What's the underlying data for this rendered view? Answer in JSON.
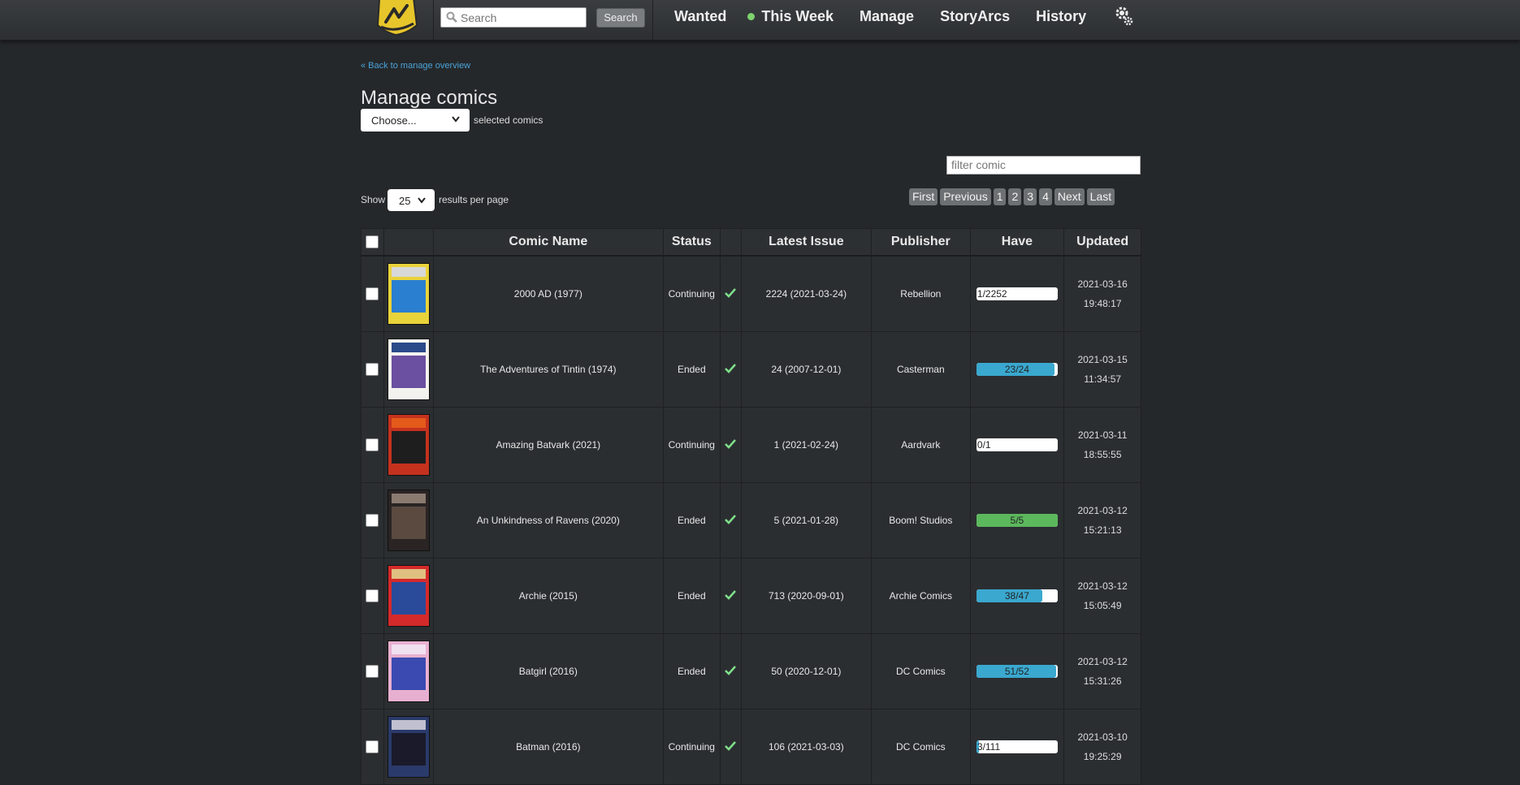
{
  "nav": {
    "search_placeholder": "Search",
    "search_button": "Search",
    "items": [
      "Wanted",
      "This Week",
      "Manage",
      "StoryArcs",
      "History"
    ],
    "active_dot_color": "#7ed36e"
  },
  "page": {
    "back_link": "« Back to manage overview",
    "title": "Manage comics",
    "action_select": "Choose...",
    "selected_label": "selected comics",
    "filter_placeholder": "filter comic",
    "show_label": "Show",
    "per_page": "25",
    "rpp_label": "results per page",
    "pager": [
      "First",
      "Previous",
      "1",
      "2",
      "3",
      "4",
      "Next",
      "Last"
    ]
  },
  "table": {
    "headers": [
      "",
      "",
      "Comic Name",
      "Status",
      "",
      "Latest Issue",
      "Publisher",
      "Have",
      "Updated"
    ],
    "rows": [
      {
        "name": "2000 AD (1977)",
        "status": "Continuing",
        "latest": "2224 (2021-03-24)",
        "publisher": "Rebellion",
        "have": "1/2252",
        "pct": 0.04,
        "color": "#3aa8cf",
        "date": "2021-03-16",
        "time": "19:48:17",
        "cover": [
          "#e9d33a",
          "#2a7fd0",
          "#d8d8d8"
        ]
      },
      {
        "name": "The Adventures of Tintin (1974)",
        "status": "Ended",
        "latest": "24 (2007-12-01)",
        "publisher": "Casterman",
        "have": "23/24",
        "pct": 95.8,
        "color": "#3aa8cf",
        "date": "2021-03-15",
        "time": "11:34:57",
        "cover": [
          "#f4f2ee",
          "#6b4fa0",
          "#2a4a8a"
        ]
      },
      {
        "name": "Amazing Batvark (2021)",
        "status": "Continuing",
        "latest": "1 (2021-02-24)",
        "publisher": "Aardvark",
        "have": "0/1",
        "pct": 0,
        "color": "#3aa8cf",
        "date": "2021-03-11",
        "time": "18:55:55",
        "cover": [
          "#c4321e",
          "#1e1e1e",
          "#e45a1a"
        ]
      },
      {
        "name": "An Unkindness of Ravens (2020)",
        "status": "Ended",
        "latest": "5 (2021-01-28)",
        "publisher": "Boom! Studios",
        "have": "5/5",
        "pct": 100,
        "color": "#5cb85c",
        "date": "2021-03-12",
        "time": "15:21:13",
        "cover": [
          "#2a2424",
          "#5a4a40",
          "#8a7a70"
        ]
      },
      {
        "name": "Archie (2015)",
        "status": "Ended",
        "latest": "713 (2020-09-01)",
        "publisher": "Archie Comics",
        "have": "38/47",
        "pct": 80.9,
        "color": "#3aa8cf",
        "date": "2021-03-12",
        "time": "15:05:49",
        "cover": [
          "#d42a2a",
          "#2a4a9a",
          "#e0c080"
        ]
      },
      {
        "name": "Batgirl (2016)",
        "status": "Ended",
        "latest": "50 (2020-12-01)",
        "publisher": "DC Comics",
        "have": "51/52",
        "pct": 98.1,
        "color": "#3aa8cf",
        "date": "2021-03-12",
        "time": "15:31:26",
        "cover": [
          "#e8b0d0",
          "#3a4ab0",
          "#f0e0f0"
        ]
      },
      {
        "name": "Batman (2016)",
        "status": "Continuing",
        "latest": "106 (2021-03-03)",
        "publisher": "DC Comics",
        "have": "3/111",
        "pct": 2.7,
        "color": "#3aa8cf",
        "date": "2021-03-10",
        "time": "19:25:29",
        "cover": [
          "#2a3a6a",
          "#1a1a2a",
          "#c0c0d0"
        ]
      }
    ]
  }
}
